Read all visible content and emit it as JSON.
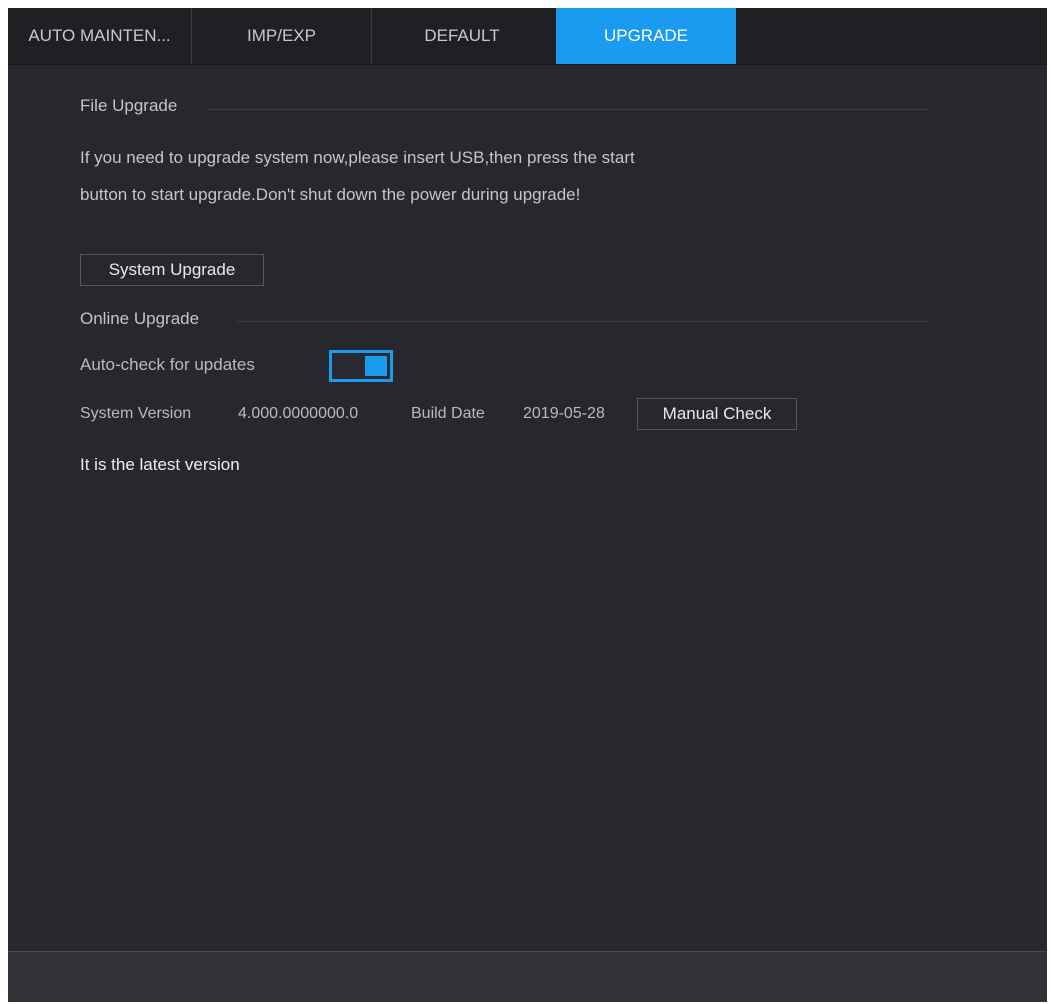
{
  "tabs": [
    {
      "label": "AUTO MAINTEN..."
    },
    {
      "label": "IMP/EXP"
    },
    {
      "label": "DEFAULT"
    },
    {
      "label": "UPGRADE",
      "active": true
    }
  ],
  "file_upgrade": {
    "title": "File Upgrade",
    "description_line1": "If you need to upgrade system now,please insert USB,then press the start",
    "description_line2": "button to start upgrade.Don't shut down the power during upgrade!",
    "system_upgrade_button": "System Upgrade"
  },
  "online_upgrade": {
    "title": "Online Upgrade",
    "auto_check_label": "Auto-check for updates",
    "auto_check_enabled": true,
    "system_version_label": "System Version",
    "system_version_value": "4.000.0000000.0",
    "build_date_label": "Build Date",
    "build_date_value": "2019-05-28",
    "manual_check_button": "Manual Check",
    "status_message": "It is the latest version"
  },
  "colors": {
    "accent": "#1a9bf0",
    "background": "#27282d",
    "tabbar": "#1f2024"
  }
}
